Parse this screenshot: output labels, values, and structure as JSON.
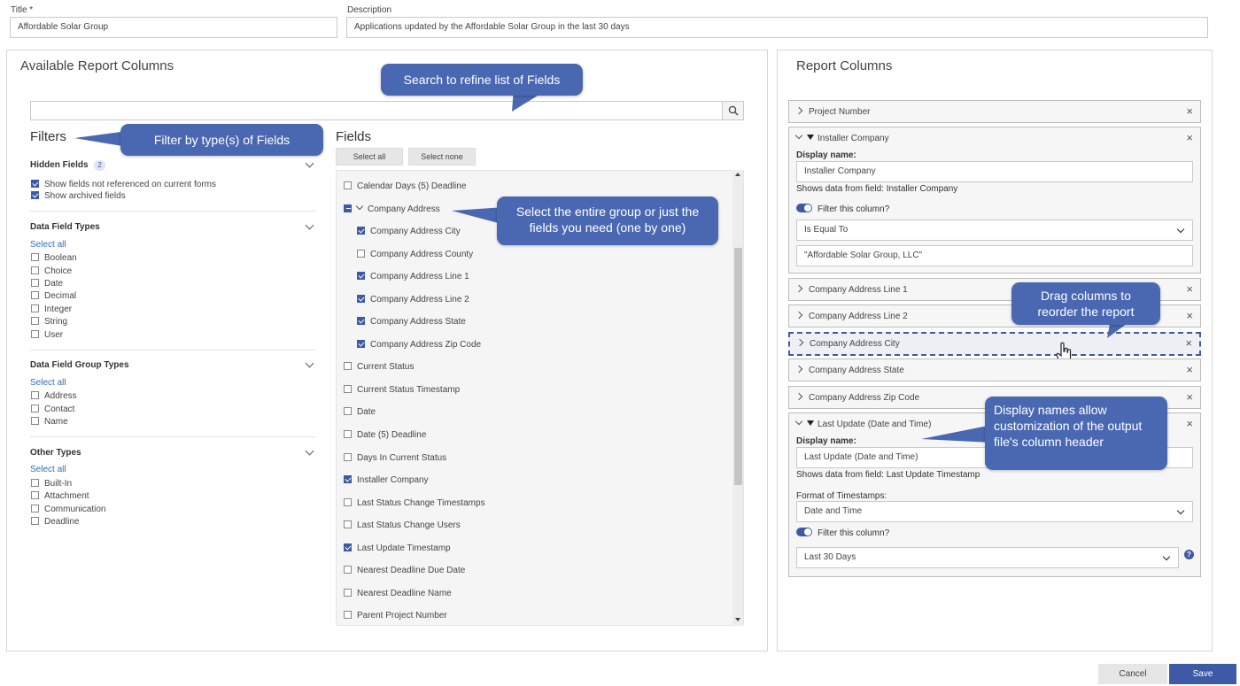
{
  "top": {
    "title_label": "Title *",
    "title_value": "Affordable Solar Group",
    "description_label": "Description",
    "description_value": "Applications updated by the Affordable Solar Group in the last 30 days"
  },
  "available": {
    "heading": "Available Report Columns",
    "search_placeholder": "",
    "filters_heading": "Filters",
    "fields_heading": "Fields",
    "select_all_btn": "Select all",
    "select_none_btn": "Select none",
    "hidden_fields": {
      "title": "Hidden Fields",
      "count": "2",
      "options": [
        "Show fields not referenced on current forms",
        "Show archived fields"
      ]
    },
    "data_field_types": {
      "title": "Data Field Types",
      "select_all": "Select all",
      "options": [
        "Boolean",
        "Choice",
        "Date",
        "Decimal",
        "Integer",
        "String",
        "User"
      ]
    },
    "data_field_group_types": {
      "title": "Data Field Group Types",
      "select_all": "Select all",
      "options": [
        "Address",
        "Contact",
        "Name"
      ]
    },
    "other_types": {
      "title": "Other Types",
      "select_all": "Select all",
      "options": [
        "Built-In",
        "Attachment",
        "Communication",
        "Deadline"
      ]
    },
    "fields": [
      {
        "label": "Calendar Days (5) Deadline",
        "checked": false
      },
      {
        "label": "Company Address",
        "checked": "partial",
        "group": true
      },
      {
        "label": "Company Address City",
        "checked": true,
        "child": true
      },
      {
        "label": "Company Address County",
        "checked": false,
        "child": true
      },
      {
        "label": "Company Address Line 1",
        "checked": true,
        "child": true
      },
      {
        "label": "Company Address Line 2",
        "checked": true,
        "child": true
      },
      {
        "label": "Company Address State",
        "checked": true,
        "child": true
      },
      {
        "label": "Company Address Zip Code",
        "checked": true,
        "child": true
      },
      {
        "label": "Current Status",
        "checked": false
      },
      {
        "label": "Current Status Timestamp",
        "checked": false
      },
      {
        "label": "Date",
        "checked": false
      },
      {
        "label": "Date (5) Deadline",
        "checked": false
      },
      {
        "label": "Days In Current Status",
        "checked": false
      },
      {
        "label": "Installer Company",
        "checked": true
      },
      {
        "label": "Last Status Change Timestamps",
        "checked": false
      },
      {
        "label": "Last Status Change Users",
        "checked": false
      },
      {
        "label": "Last Update Timestamp",
        "checked": true
      },
      {
        "label": "Nearest Deadline Due Date",
        "checked": false
      },
      {
        "label": "Nearest Deadline Name",
        "checked": false
      },
      {
        "label": "Parent Project Number",
        "checked": false
      }
    ]
  },
  "report": {
    "heading": "Report Columns",
    "project_number": "Project Number",
    "installer": {
      "title": "Installer Company",
      "display_name_label": "Display name:",
      "display_name_value": "Installer Company",
      "shows_data": "Shows data from field: Installer Company",
      "filter_label": "Filter this column?",
      "operator": "Is Equal To",
      "value": "\"Affordable Solar Group, LLC\""
    },
    "collapsed": [
      "Company Address Line 1",
      "Company Address Line 2",
      "Company Address City",
      "Company Address State",
      "Company Address Zip Code"
    ],
    "last_update": {
      "title": "Last Update (Date and Time)",
      "display_name_label": "Display name:",
      "display_name_value": "Last Update (Date and Time)",
      "shows_data": "Shows data from field: Last Update Timestamp",
      "format_label": "Format of Timestamps:",
      "format_value": "Date and Time",
      "filter_label": "Filter this column?",
      "range_value": "Last 30 Days",
      "help_icon": "?"
    }
  },
  "callouts": {
    "search": "Search to refine list of Fields",
    "filter": "Filter by type(s) of Fields",
    "select_group": "Select the entire group or just the fields you need (one by one)",
    "drag": "Drag columns to reorder the report",
    "display_names": "Display names allow customization of the output file's column header"
  },
  "footer": {
    "cancel": "Cancel",
    "save": "Save"
  },
  "colors": {
    "accent": "#3e5aa6",
    "callout": "#4a68b2",
    "link": "#2f6fb5"
  }
}
